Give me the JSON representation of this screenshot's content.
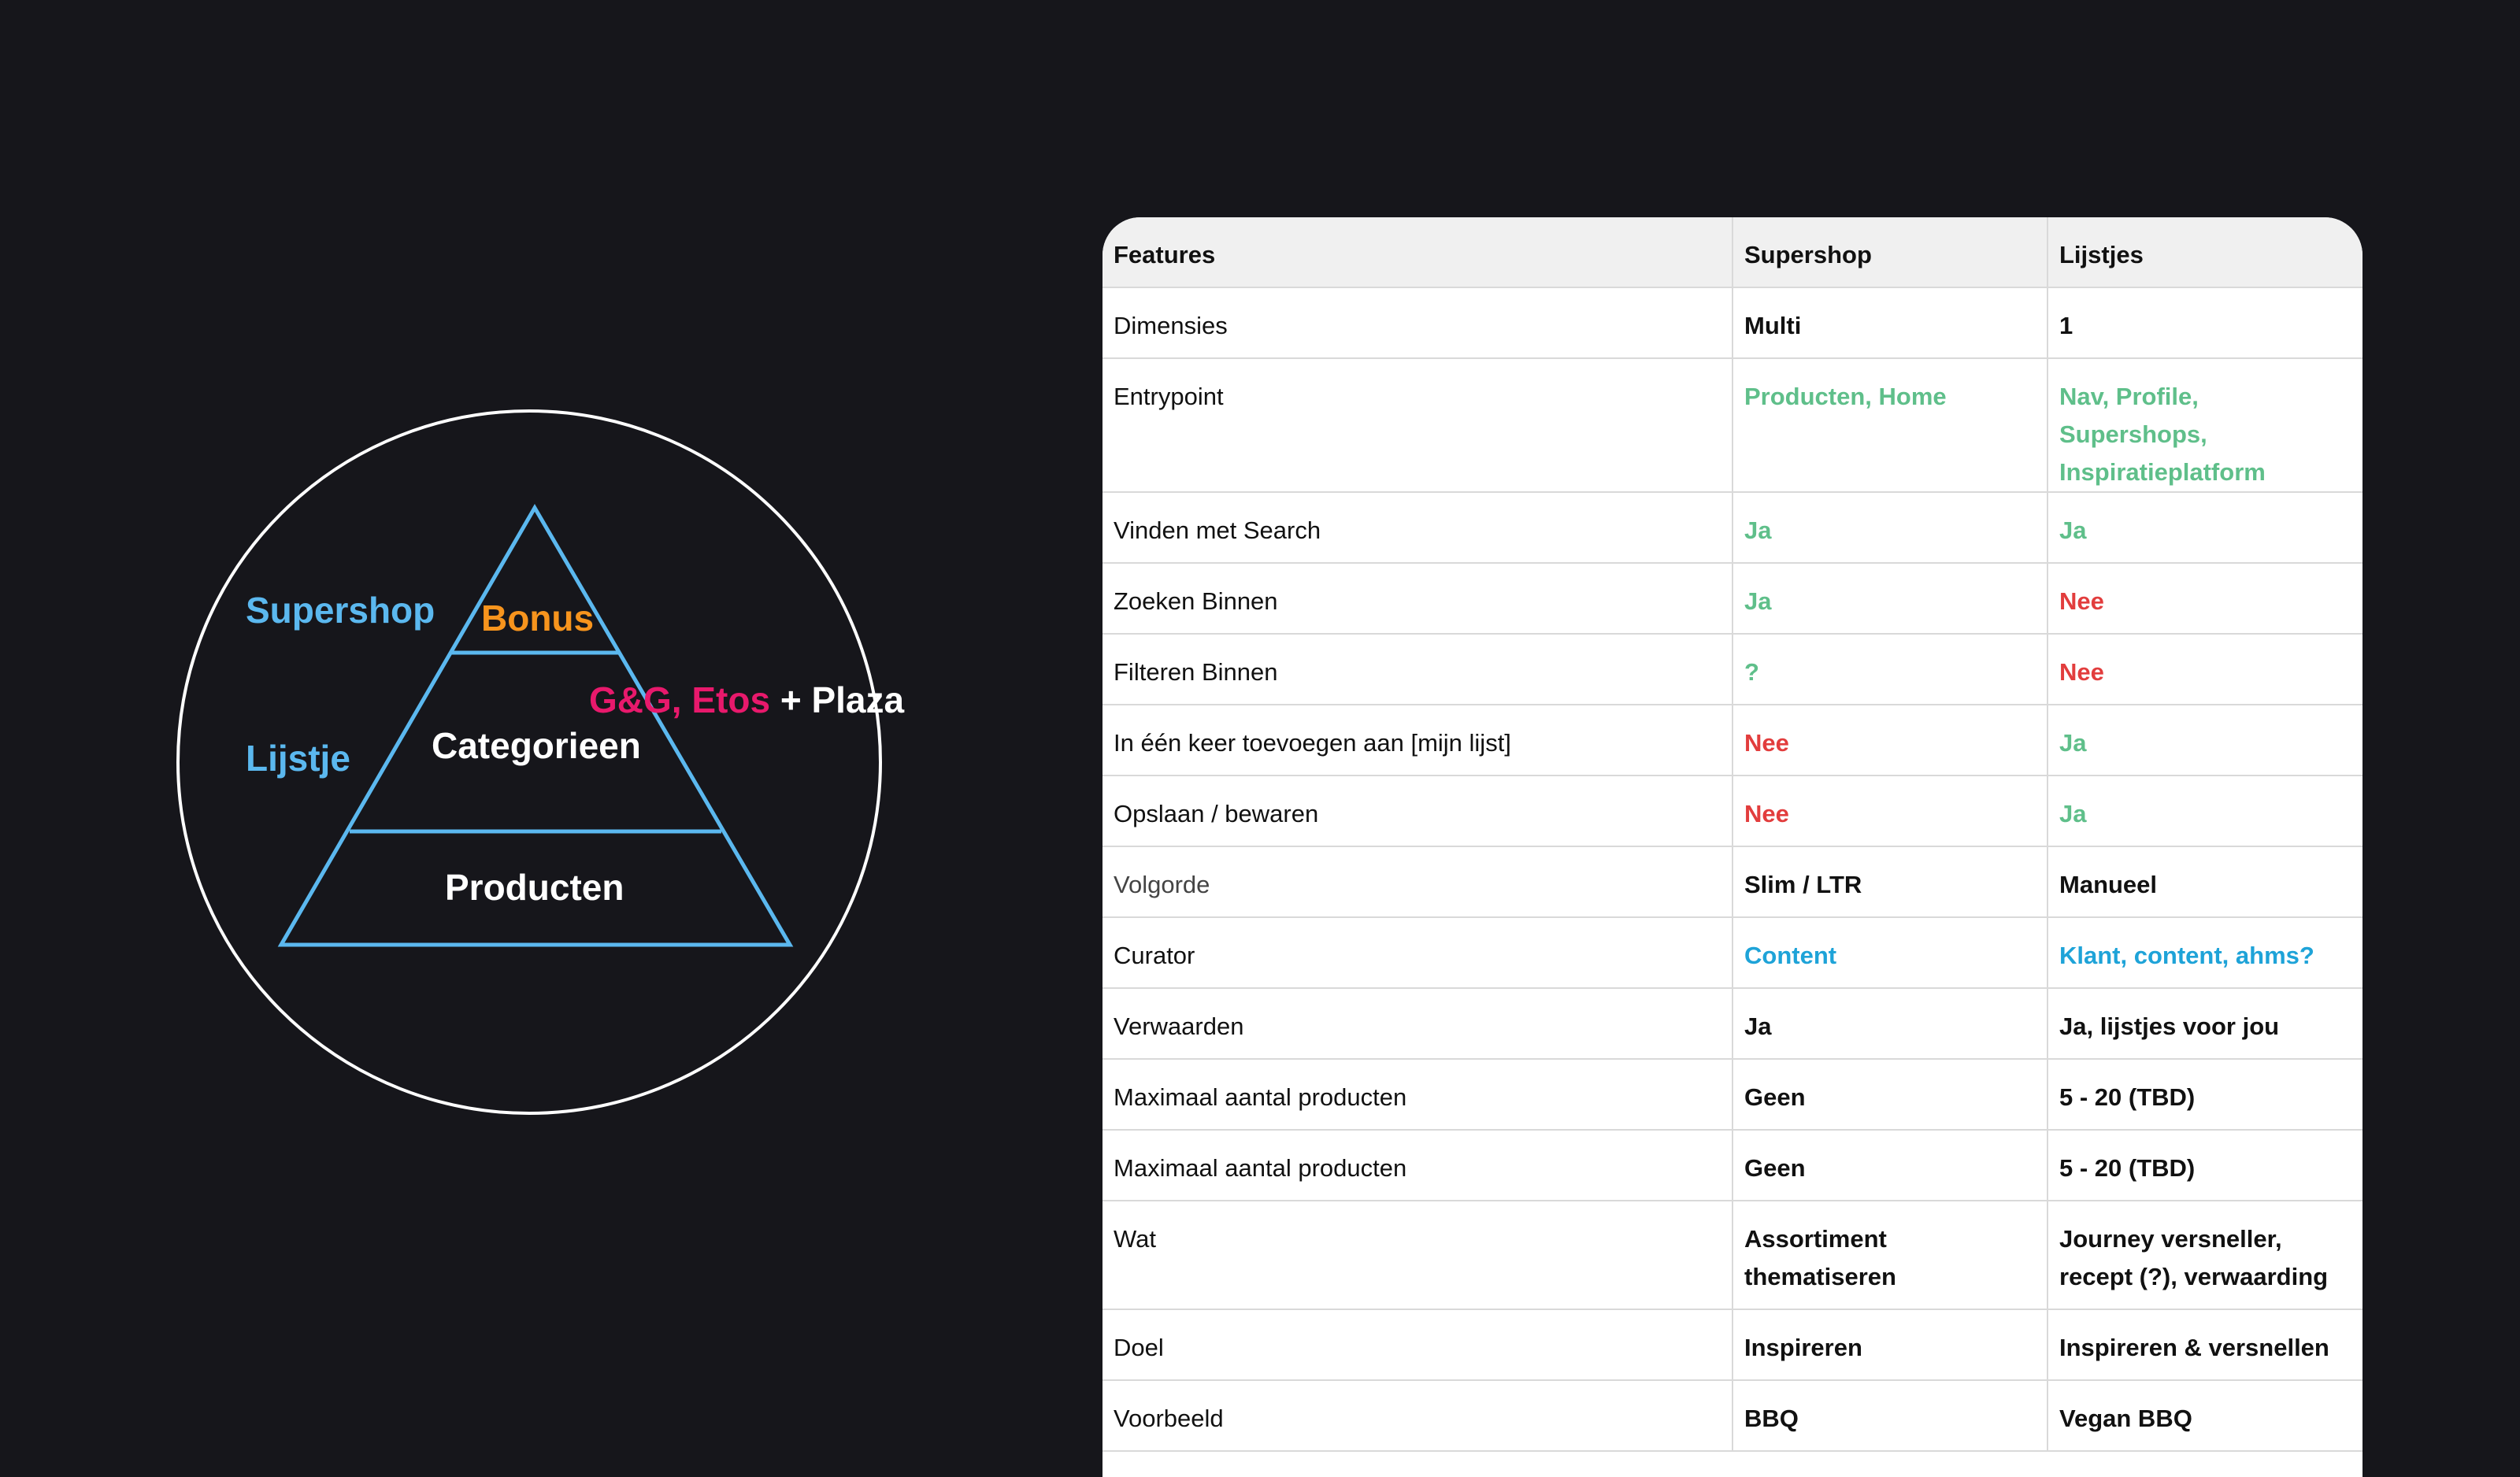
{
  "diagram": {
    "labels": {
      "supershop": "Supershop",
      "lijstje": "Lijstje",
      "bonus": "Bonus",
      "categorieen": "Categorieen",
      "producten": "Producten",
      "brands": "G&G, Etos",
      "plaza": "+ Plaza"
    },
    "colors": {
      "circle": "#ffffff",
      "pyramid": "#5bb8ef",
      "supershop": "#5bb8ef",
      "lijstje": "#5bb8ef",
      "bonus": "#f7941d",
      "brands": "#e8196c",
      "plaza": "#ffffff"
    }
  },
  "table": {
    "headers": [
      "Features",
      "Supershop",
      "Lijstjes"
    ],
    "rows": [
      {
        "feature": "Dimensies",
        "supershop": "Multi",
        "lijstjes": "1",
        "s_color": "black",
        "l_color": "black"
      },
      {
        "feature": "Entrypoint",
        "supershop": "Producten, Home",
        "lijstjes": "Nav, Profile, Supershops, Inspiratieplatform",
        "s_color": "green",
        "l_color": "green",
        "tall": true
      },
      {
        "feature": "Vinden met Search",
        "supershop": "Ja",
        "lijstjes": "Ja",
        "s_color": "green",
        "l_color": "green"
      },
      {
        "feature": "Zoeken Binnen",
        "supershop": "Ja",
        "lijstjes": "Nee",
        "s_color": "green",
        "l_color": "red"
      },
      {
        "feature": "Filteren Binnen",
        "supershop": "?",
        "lijstjes": "Nee",
        "s_color": "green",
        "l_color": "red"
      },
      {
        "feature": "In één keer toevoegen aan [mijn lijst]",
        "supershop": "Nee",
        "lijstjes": "Ja",
        "s_color": "red",
        "l_color": "green"
      },
      {
        "feature": "Opslaan / bewaren",
        "supershop": "Nee",
        "lijstjes": "Ja",
        "s_color": "red",
        "l_color": "green"
      },
      {
        "feature": "Volgorde",
        "supershop": "Slim / LTR",
        "lijstjes": "Manueel",
        "s_color": "black",
        "l_color": "black",
        "light": true
      },
      {
        "feature": "Curator",
        "supershop": "Content",
        "lijstjes": "Klant, content, ahms?",
        "s_color": "blue",
        "l_color": "blue"
      },
      {
        "feature": "Verwaarden",
        "supershop": "Ja",
        "lijstjes": "Ja, lijstjes voor jou",
        "s_color": "black",
        "l_color": "black"
      },
      {
        "feature": "Maximaal aantal producten",
        "supershop": "Geen",
        "lijstjes": "5 - 20 (TBD)",
        "s_color": "black",
        "l_color": "black"
      },
      {
        "feature": "Maximaal aantal producten",
        "supershop": "Geen",
        "lijstjes": "5 - 20 (TBD)",
        "s_color": "black",
        "l_color": "black"
      },
      {
        "feature": "Wat",
        "supershop": "Assortiment thematiseren",
        "lijstjes": "Journey versneller, recept (?), verwaarding",
        "s_color": "black",
        "l_color": "black",
        "tall": true
      },
      {
        "feature": "Doel",
        "supershop": "Inspireren",
        "lijstjes": "Inspireren & versnellen",
        "s_color": "black",
        "l_color": "black"
      },
      {
        "feature": "Voorbeeld",
        "supershop": "BBQ",
        "lijstjes": "Vegan BBQ",
        "s_color": "black",
        "l_color": "black"
      }
    ]
  }
}
